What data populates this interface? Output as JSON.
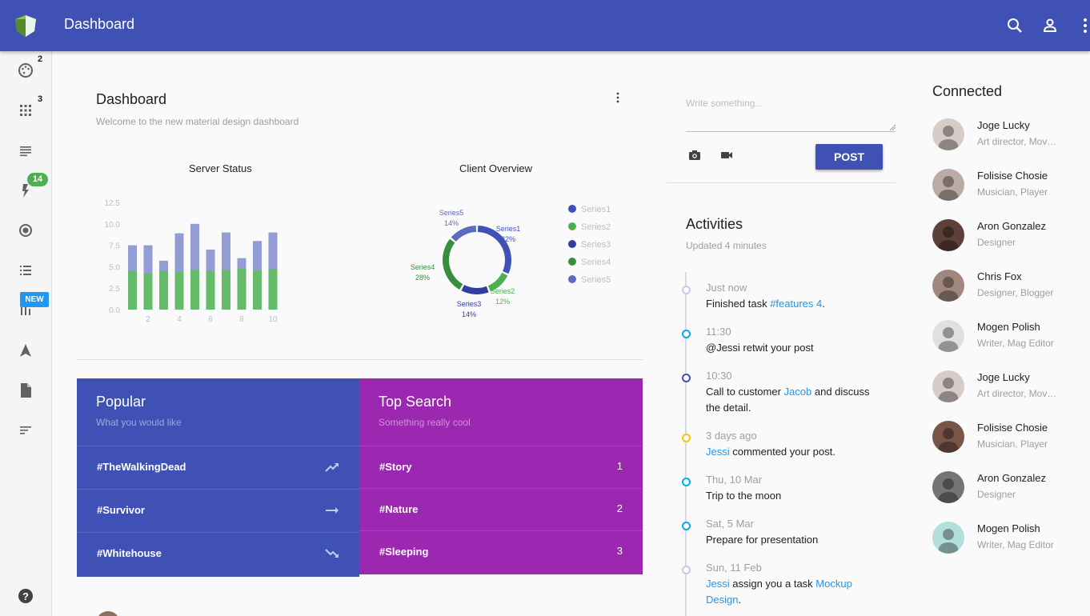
{
  "header": {
    "title": "Dashboard",
    "icons": [
      "search-icon",
      "account-icon",
      "more-vert-icon"
    ],
    "color": "#3f51b5"
  },
  "sidebar": {
    "items": [
      {
        "icon": "palette-icon",
        "badge": "2"
      },
      {
        "icon": "apps-grid-icon",
        "badge": "3"
      },
      {
        "icon": "text-lines-icon"
      },
      {
        "icon": "flash-icon",
        "badge": "14"
      },
      {
        "icon": "radio-button-icon"
      },
      {
        "icon": "list-icon"
      },
      {
        "icon": "equalizer-icon",
        "badge": "NEW"
      },
      {
        "icon": "navigation-icon"
      },
      {
        "icon": "file-icon"
      },
      {
        "icon": "sort-icon"
      },
      {
        "icon": "help-icon"
      }
    ]
  },
  "dashboard": {
    "title": "Dashboard",
    "subtitle": "Welcome to the new material design dashboard"
  },
  "chart_data": [
    {
      "type": "bar",
      "title": "Server Status",
      "x": [
        1,
        2,
        3,
        4,
        5,
        6,
        7,
        8,
        9,
        10
      ],
      "x_tick_labels": [
        "2",
        "4",
        "6",
        "8",
        "10"
      ],
      "ylim": [
        0,
        12.5
      ],
      "y_ticks": [
        "0.0",
        "2.5",
        "5.0",
        "7.5",
        "10.0",
        "12.5"
      ],
      "series": [
        {
          "values": [
            7.5,
            7.5,
            5.7,
            8.9,
            10.0,
            7.0,
            9.0,
            6.0,
            8.0,
            9.0
          ],
          "color": "#7986cb"
        },
        {
          "values": [
            4.5,
            4.2,
            4.5,
            4.4,
            4.6,
            4.5,
            4.6,
            4.8,
            4.6,
            4.7
          ],
          "color": "#66bb6a"
        }
      ]
    },
    {
      "type": "pie",
      "title": "Client Overview",
      "series": [
        {
          "name": "Series1",
          "label": "32%",
          "value": 32,
          "color": "#3f51b5"
        },
        {
          "name": "Series2",
          "label": "12%",
          "value": 12,
          "color": "#4caf50"
        },
        {
          "name": "Series3",
          "label": "14%",
          "value": 14,
          "color": "#303f9f"
        },
        {
          "name": "Series4",
          "label": "28%",
          "value": 28,
          "color": "#388e3c"
        },
        {
          "name": "Series5",
          "label": "14%",
          "value": 14,
          "color": "#5c6bc0"
        }
      ],
      "legend": "right"
    }
  ],
  "popular": {
    "title": "Popular",
    "subtitle": "What you would like",
    "color": "#3f51b5",
    "items": [
      {
        "label": "#TheWalkingDead",
        "icon": "trending-up-icon"
      },
      {
        "label": "#Survivor",
        "icon": "trending-flat-icon"
      },
      {
        "label": "#Whitehouse",
        "icon": "trending-down-icon"
      }
    ]
  },
  "top_search": {
    "title": "Top Search",
    "subtitle": "Something really cool",
    "color": "#9c27b0",
    "items": [
      {
        "label": "#Story",
        "rank": "1"
      },
      {
        "label": "#Nature",
        "rank": "2"
      },
      {
        "label": "#Sleeping",
        "rank": "3"
      }
    ]
  },
  "composer": {
    "placeholder": "Write something...",
    "post_label": "POST"
  },
  "activities": {
    "title": "Activities",
    "subtitle": "Updated 4 minutes",
    "items": [
      {
        "time": "Just now",
        "pre": "Finished task ",
        "link": "#features 4",
        "post": ".",
        "dot": "#c5cae9"
      },
      {
        "time": "11:30",
        "pre": "@Jessi retwit your post",
        "link": "",
        "post": "",
        "dot": "#03a9f4"
      },
      {
        "time": "10:30",
        "pre": "Call to customer ",
        "link": "Jacob",
        "post": " and discuss the detail.",
        "dot": "#3f51b5"
      },
      {
        "time": "3 days ago",
        "pre": "",
        "link": "Jessi",
        "post": " commented your post.",
        "dot": "#ffc107"
      },
      {
        "time": "Thu, 10 Mar",
        "pre": "Trip to the moon",
        "link": "",
        "post": "",
        "dot": "#03a9f4"
      },
      {
        "time": "Sat, 5 Mar",
        "pre": "Prepare for presentation",
        "link": "",
        "post": "",
        "dot": "#03a9f4"
      },
      {
        "time": "Sun, 11 Feb",
        "pre": "",
        "link": "Jessi",
        "post": " assign you a task ",
        "link2": "Mockup Design",
        "post2": ".",
        "dot": "#c5cae9"
      }
    ]
  },
  "connected": {
    "title": "Connected",
    "people": [
      {
        "name": "Joge Lucky",
        "role": "Art director, Movie Cut"
      },
      {
        "name": "Folisise Chosie",
        "role": "Musician, Player"
      },
      {
        "name": "Aron Gonzalez",
        "role": "Designer"
      },
      {
        "name": "Chris Fox",
        "role": "Designer, Blogger"
      },
      {
        "name": "Mogen Polish",
        "role": "Writer, Mag Editor"
      },
      {
        "name": "Joge Lucky",
        "role": "Art director, Movie Cut"
      },
      {
        "name": "Folisise Chosie",
        "role": "Musician, Player"
      },
      {
        "name": "Aron Gonzalez",
        "role": "Designer"
      },
      {
        "name": "Mogen Polish",
        "role": "Writer, Mag Editor"
      }
    ]
  }
}
